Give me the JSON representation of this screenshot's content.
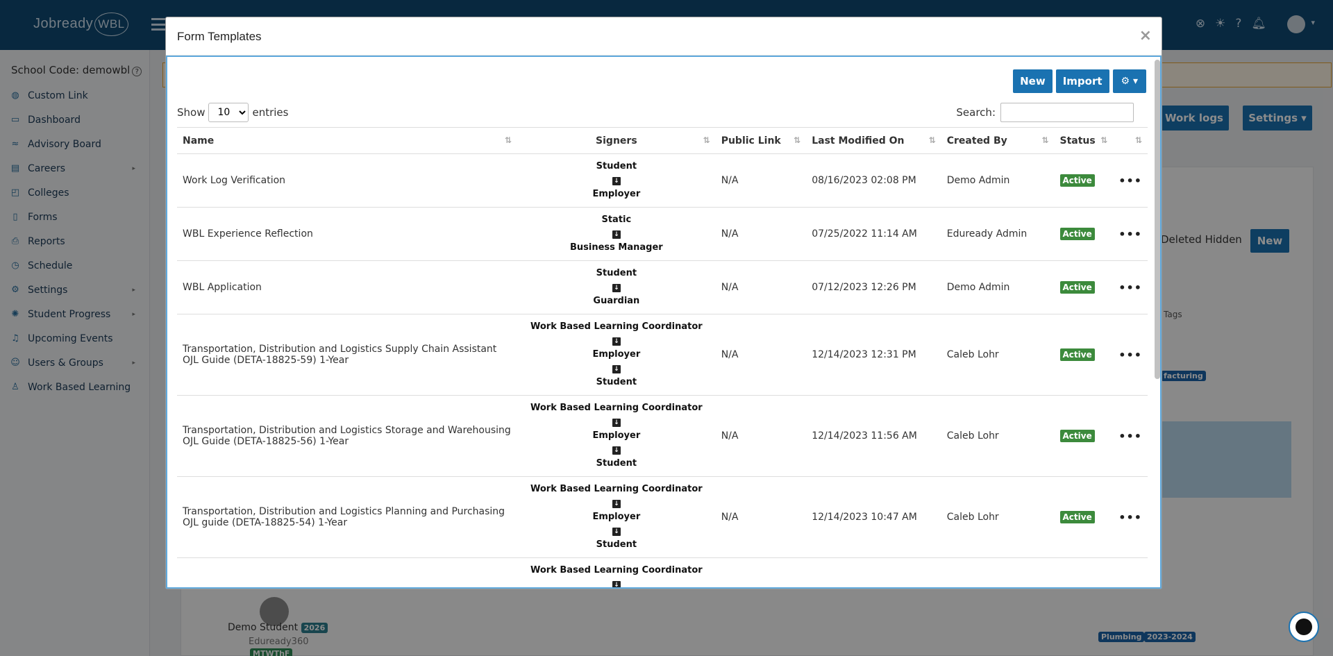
{
  "app": {
    "logo_text": "Jobready",
    "logo_badge": "WBL"
  },
  "topbar": {
    "icons": [
      "help-circle-icon",
      "lightbulb-icon",
      "question-icon",
      "bell-icon"
    ]
  },
  "sidebar": {
    "school_code": "School Code: demowbl",
    "items": [
      {
        "label": "Custom Link",
        "icon": "globe-icon",
        "has_children": false
      },
      {
        "label": "Dashboard",
        "icon": "monitor-icon",
        "has_children": false
      },
      {
        "label": "Advisory Board",
        "icon": "trend-icon",
        "has_children": false
      },
      {
        "label": "Careers",
        "icon": "briefcase-icon",
        "has_children": true
      },
      {
        "label": "Colleges",
        "icon": "college-icon",
        "has_children": false
      },
      {
        "label": "Forms",
        "icon": "document-icon",
        "has_children": false
      },
      {
        "label": "Reports",
        "icon": "printer-icon",
        "has_children": false
      },
      {
        "label": "Schedule",
        "icon": "clock-icon",
        "has_children": false
      },
      {
        "label": "Settings",
        "icon": "gears-icon",
        "has_children": true
      },
      {
        "label": "Student Progress",
        "icon": "spinner-icon",
        "has_children": true
      },
      {
        "label": "Upcoming Events",
        "icon": "bell-icon",
        "has_children": false
      },
      {
        "label": "Users & Groups",
        "icon": "users-icon",
        "has_children": true
      },
      {
        "label": "Work Based Learning",
        "icon": "person-icon",
        "has_children": false
      }
    ]
  },
  "background": {
    "buttons": {
      "work_logs": "ng Work logs",
      "settings": "Settings",
      "new": "New"
    },
    "deleted_hidden": "Deleted Hidden",
    "tags_header": "Tags",
    "tag_facturing": "facturing",
    "student": {
      "name": "Demo Student",
      "year": "2026",
      "org": "Eduready360",
      "days": "MTWThF"
    },
    "tags": [
      "Plumbing",
      "2023-2024"
    ]
  },
  "modal": {
    "title": "Form Templates",
    "close": "×",
    "toolbar": {
      "new_label": "New",
      "import_label": "Import",
      "gear_label": "⚙ ▾"
    },
    "show_label": "Show",
    "entries_label": "entries",
    "page_size": "10",
    "search_label": "Search:",
    "search_value": "",
    "columns": [
      "Name",
      "Signers",
      "Public Link",
      "Last Modified On",
      "Created By",
      "Status",
      ""
    ],
    "rows": [
      {
        "name": "Work Log Verification",
        "signers": [
          "Student",
          "Employer"
        ],
        "public_link": "N/A",
        "modified": "08/16/2023 02:08 PM",
        "created_by": "Demo Admin",
        "status": "Active"
      },
      {
        "name": "WBL Experience Reflection",
        "signers": [
          "Static",
          "Business Manager"
        ],
        "public_link": "N/A",
        "modified": "07/25/2022 11:14 AM",
        "created_by": "Eduready Admin",
        "status": "Active"
      },
      {
        "name": "WBL Application",
        "signers": [
          "Student",
          "Guardian"
        ],
        "public_link": "N/A",
        "modified": "07/12/2023 12:26 PM",
        "created_by": "Demo Admin",
        "status": "Active"
      },
      {
        "name": "Transportation, Distribution and Logistics Supply Chain Assistant OJL Guide (DETA-18825-59) 1-Year",
        "signers": [
          "Work Based Learning Coordinator",
          "Employer",
          "Student"
        ],
        "public_link": "N/A",
        "modified": "12/14/2023 12:31 PM",
        "created_by": "Caleb Lohr",
        "status": "Active"
      },
      {
        "name": "Transportation, Distribution and Logistics Storage and Warehousing OJL Guide (DETA-18825-56) 1-Year",
        "signers": [
          "Work Based Learning Coordinator",
          "Employer",
          "Student"
        ],
        "public_link": "N/A",
        "modified": "12/14/2023 11:56 AM",
        "created_by": "Caleb Lohr",
        "status": "Active"
      },
      {
        "name": "Transportation, Distribution and Logistics Planning and Purchasing OJL guide (DETA-18825-54) 1-Year",
        "signers": [
          "Work Based Learning Coordinator",
          "Employer",
          "Student"
        ],
        "public_link": "N/A",
        "modified": "12/14/2023 10:47 AM",
        "created_by": "Caleb Lohr",
        "status": "Active"
      },
      {
        "name": "",
        "signers": [
          "Work Based Learning Coordinator"
        ],
        "public_link": "",
        "modified": "",
        "created_by": "",
        "status": ""
      }
    ]
  }
}
